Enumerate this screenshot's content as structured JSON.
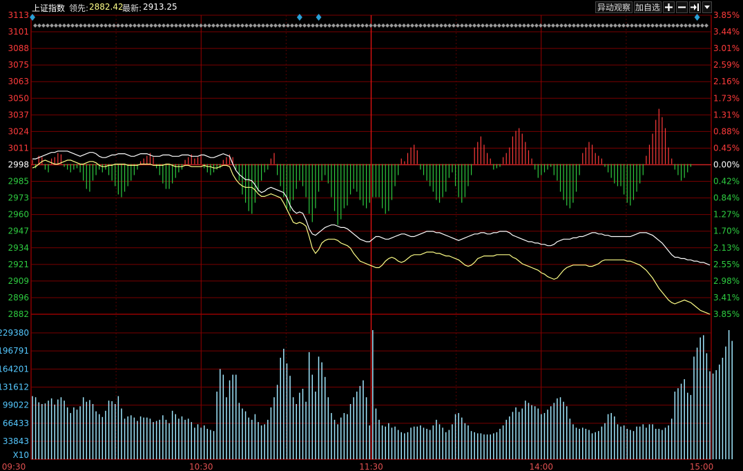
{
  "header": {
    "index_name": "上证指数",
    "lead_label": "领先:",
    "lead_value": "2882.42",
    "latest_label": "最新:",
    "latest_value": "2913.25",
    "buttons": {
      "watch": "异动观察",
      "add_watchlist": "加自选"
    },
    "icons": [
      "plus-icon",
      "minus-icon",
      "jump-end-icon",
      "dropdown-icon"
    ]
  },
  "colors": {
    "up": "#ff3b3b",
    "down": "#2ecc40",
    "grid": "#7a0000",
    "axis": "#cc0000",
    "volume": "#a0e8ff",
    "index_line": "#ffffff",
    "lead_line": "#ffff88",
    "marker": "#2a9fd6"
  },
  "chart_data": {
    "type": "line",
    "title": "",
    "price_axis_labels": [
      "3113",
      "3101",
      "3088",
      "3075",
      "3063",
      "3050",
      "3037",
      "3024",
      "3011",
      "2998",
      "2985",
      "2973",
      "2960",
      "2947",
      "2934",
      "2921",
      "2909",
      "2896",
      "2882"
    ],
    "percent_axis_labels": [
      "3.85%",
      "3.44%",
      "3.01%",
      "2.59%",
      "2.16%",
      "1.73%",
      "1.31%",
      "0.88%",
      "0.45%",
      "0.00%",
      "0.42%",
      "0.84%",
      "1.27%",
      "1.70%",
      "2.13%",
      "2.55%",
      "2.98%",
      "3.41%",
      "3.85%"
    ],
    "ylim": [
      2882,
      3113
    ],
    "prev_close": 2998,
    "time_labels": [
      "09:30",
      "10:30",
      "11:30",
      "14:00",
      "15:00"
    ],
    "volume_axis_labels": [
      "229380",
      "196791",
      "164201",
      "131612",
      "99022",
      "66433",
      "33843"
    ],
    "volume_unit": "X10",
    "volume_ylim": [
      0,
      245000
    ],
    "series": [
      {
        "key": "index",
        "values": [
          3002,
          3002,
          3003,
          3004,
          3005,
          3006,
          3007,
          3007,
          3008,
          3008,
          3008,
          3008,
          3007,
          3006,
          3005,
          3004,
          3005,
          3006,
          3007,
          3007,
          3006,
          3004,
          3003,
          3003,
          3004,
          3005,
          3005,
          3006,
          3006,
          3006,
          3005,
          3004,
          3004,
          3005,
          3006,
          3006,
          3006,
          3005,
          3004,
          3004,
          3004,
          3005,
          3005,
          3005,
          3004,
          3004,
          3004,
          3005,
          3005,
          3005,
          3004,
          3004,
          3004,
          3005,
          3005,
          3004,
          3003,
          3003,
          3004,
          3005,
          3006,
          3005,
          3004,
          2998,
          2993,
          2990,
          2988,
          2986,
          2986,
          2985,
          2982,
          2978,
          2976,
          2977,
          2979,
          2980,
          2979,
          2978,
          2977,
          2976,
          2972,
          2966,
          2962,
          2960,
          2961,
          2960,
          2955,
          2948,
          2944,
          2943,
          2945,
          2947,
          2949,
          2950,
          2951,
          2951,
          2950,
          2949,
          2949,
          2948,
          2946,
          2944,
          2942,
          2940,
          2939,
          2938,
          2938,
          2940,
          2942,
          2942,
          2941,
          2940,
          2940,
          2941,
          2942,
          2943,
          2944,
          2944,
          2943,
          2942,
          2942,
          2943,
          2944,
          2945,
          2946,
          2946,
          2946,
          2945,
          2945,
          2944,
          2943,
          2942,
          2941,
          2940,
          2939,
          2940,
          2941,
          2942,
          2943,
          2944,
          2944,
          2945,
          2945,
          2944,
          2944,
          2945,
          2945,
          2946,
          2946,
          2946,
          2945,
          2943,
          2942,
          2941,
          2940,
          2939,
          2938,
          2938,
          2937,
          2937,
          2936,
          2936,
          2935,
          2935,
          2936,
          2938,
          2939,
          2940,
          2940,
          2940,
          2941,
          2941,
          2942,
          2942,
          2943,
          2944,
          2945,
          2945,
          2944,
          2944,
          2943,
          2943,
          2942,
          2942,
          2942,
          2942,
          2942,
          2942,
          2942,
          2943,
          2944,
          2945,
          2945,
          2945,
          2944,
          2943,
          2941,
          2939,
          2937,
          2934,
          2931,
          2928,
          2926,
          2926,
          2925,
          2925,
          2924,
          2924,
          2923,
          2923,
          2922,
          2922,
          2921,
          2920
        ],
        "color": "#ffffff"
      },
      {
        "key": "lead",
        "values": [
          2995,
          2996,
          2998,
          3000,
          3001,
          3000,
          2999,
          2998,
          2998,
          2999,
          3000,
          3001,
          3001,
          3000,
          2999,
          2998,
          2998,
          2999,
          3000,
          3000,
          2999,
          2997,
          2996,
          2996,
          2997,
          2997,
          2998,
          2998,
          2998,
          2998,
          2997,
          2997,
          2997,
          2997,
          2998,
          2998,
          2998,
          2998,
          2997,
          2997,
          2997,
          2997,
          2998,
          2998,
          2997,
          2996,
          2996,
          2996,
          2997,
          2997,
          2996,
          2996,
          2996,
          2996,
          2997,
          2996,
          2996,
          2995,
          2995,
          2996,
          2997,
          2997,
          2996,
          2990,
          2986,
          2983,
          2981,
          2980,
          2980,
          2980,
          2978,
          2975,
          2973,
          2973,
          2974,
          2975,
          2974,
          2973,
          2972,
          2968,
          2963,
          2958,
          2953,
          2952,
          2953,
          2952,
          2950,
          2942,
          2933,
          2929,
          2932,
          2937,
          2939,
          2940,
          2940,
          2940,
          2939,
          2937,
          2936,
          2935,
          2933,
          2929,
          2926,
          2923,
          2922,
          2921,
          2920,
          2919,
          2918,
          2918,
          2920,
          2923,
          2925,
          2926,
          2925,
          2923,
          2922,
          2923,
          2925,
          2927,
          2928,
          2928,
          2928,
          2929,
          2930,
          2930,
          2930,
          2929,
          2929,
          2928,
          2927,
          2927,
          2926,
          2925,
          2924,
          2922,
          2920,
          2919,
          2920,
          2922,
          2925,
          2926,
          2927,
          2927,
          2927,
          2927,
          2928,
          2928,
          2928,
          2928,
          2928,
          2926,
          2925,
          2923,
          2921,
          2920,
          2919,
          2918,
          2917,
          2916,
          2914,
          2913,
          2911,
          2910,
          2909,
          2910,
          2913,
          2916,
          2918,
          2919,
          2920,
          2920,
          2920,
          2920,
          2920,
          2919,
          2919,
          2920,
          2921,
          2923,
          2924,
          2924,
          2924,
          2924,
          2924,
          2924,
          2924,
          2923,
          2923,
          2922,
          2921,
          2920,
          2918,
          2916,
          2913,
          2910,
          2906,
          2902,
          2899,
          2896,
          2893,
          2891,
          2890,
          2891,
          2892,
          2893,
          2892,
          2891,
          2889,
          2887,
          2885,
          2884,
          2883,
          2882
        ],
        "color": "#ffff88"
      }
    ],
    "ratio_bars": [
      1.5,
      -1.5,
      3,
      2.5,
      -2,
      -3,
      2,
      2.5,
      4,
      3.5,
      -1,
      -2,
      -3,
      -2,
      -1.5,
      -3,
      -6,
      -9,
      -10,
      -6,
      -4,
      -2,
      -3,
      -2,
      -4,
      -6,
      -8,
      -11,
      -12,
      -10,
      -8,
      -6,
      -4,
      -2,
      1,
      2,
      3,
      4,
      2.5,
      -1.5,
      -4,
      -7,
      -9,
      -9,
      -7,
      -5,
      -3,
      -2,
      1.5,
      2.5,
      3.5,
      2,
      2.5,
      3,
      -1.5,
      -3,
      -4,
      -3,
      -2,
      -1.5,
      1.5,
      2.5,
      3.5,
      2.5,
      -2,
      -6,
      -11,
      -14,
      -17,
      -18,
      -14,
      -10,
      -6,
      -3,
      -2,
      2,
      4,
      -4,
      -8,
      -12,
      -16,
      -17,
      -13,
      -9,
      -6,
      -8,
      -12,
      -18,
      -21,
      -16,
      -10,
      -6,
      -4,
      -7,
      -12,
      -17,
      -22,
      -20,
      -16,
      -15,
      -11,
      -9,
      -10,
      -13,
      -15,
      -16,
      -14,
      -12,
      -12,
      -12,
      -16,
      -18,
      -17,
      -13,
      -8,
      -4,
      2,
      1,
      4,
      6,
      7,
      5,
      -2,
      -4,
      -6,
      -8,
      -10,
      -13,
      -14,
      -12,
      -10,
      -5,
      -3,
      -8,
      -12,
      -14,
      -12,
      -8,
      -4,
      6,
      8,
      10,
      7,
      4,
      2,
      -2,
      -1.5,
      -1,
      2.5,
      4,
      6,
      10,
      12,
      13,
      11,
      8,
      5,
      2,
      -2,
      -5,
      -4,
      -3,
      -2,
      -1,
      -4,
      -6,
      -10,
      -13,
      -15,
      -16,
      -14,
      -10,
      -4,
      4,
      6,
      8,
      7,
      4,
      3,
      2,
      -1,
      -3,
      -5,
      -7,
      -8,
      -8,
      -11,
      -14,
      -15,
      -13,
      -10,
      -7,
      -4,
      3,
      7,
      11,
      16,
      20,
      17,
      13,
      6,
      2,
      -2,
      -4,
      -6,
      -5,
      -3,
      -1
    ],
    "volume": [
      112000,
      110000,
      101000,
      98000,
      99000,
      104000,
      108000,
      97000,
      106000,
      110000,
      104000,
      92000,
      82000,
      92000,
      88000,
      94000,
      110000,
      102000,
      105000,
      98000,
      85000,
      80000,
      75000,
      86000,
      104000,
      103000,
      98000,
      112000,
      90000,
      72000,
      76000,
      78000,
      74000,
      68000,
      76000,
      74000,
      74000,
      72000,
      66000,
      68000,
      70000,
      78000,
      70000,
      64000,
      86000,
      80000,
      72000,
      76000,
      70000,
      72000,
      66000,
      56000,
      62000,
      56000,
      60000,
      54000,
      52000,
      50000,
      120000,
      160000,
      150000,
      110000,
      140000,
      150000,
      150000,
      100000,
      90000,
      85000,
      74000,
      70000,
      80000,
      66000,
      60000,
      62000,
      70000,
      92000,
      110000,
      132000,
      180000,
      196000,
      170000,
      148000,
      110000,
      98000,
      118000,
      125000,
      102000,
      190000,
      150000,
      120000,
      182000,
      172000,
      146000,
      110000,
      82000,
      70000,
      62000,
      74000,
      82000,
      80000,
      98000,
      110000,
      120000,
      130000,
      140000,
      110000,
      60000,
      229000,
      90000,
      70000,
      60000,
      58000,
      64000,
      56000,
      58000,
      52000,
      48000,
      46000,
      48000,
      56000,
      58000,
      58000,
      60000,
      56000,
      54000,
      52000,
      60000,
      70000,
      62000,
      56000,
      48000,
      52000,
      62000,
      80000,
      82000,
      74000,
      64000,
      60000,
      50000,
      48000,
      46000,
      46000,
      44000,
      44000,
      44000,
      46000,
      48000,
      54000,
      60000,
      70000,
      76000,
      84000,
      92000,
      84000,
      90000,
      104000,
      100000,
      96000,
      94000,
      90000,
      80000,
      82000,
      88000,
      94000,
      100000,
      108000,
      110000,
      102000,
      94000,
      72000,
      62000,
      56000,
      54000,
      56000,
      54000,
      52000,
      46000,
      48000,
      50000,
      58000,
      64000,
      80000,
      82000,
      76000,
      62000,
      58000,
      60000,
      54000,
      52000,
      50000,
      58000,
      58000,
      62000,
      56000,
      62000,
      62000,
      54000,
      54000,
      52000,
      56000,
      60000,
      72000,
      120000,
      126000,
      134000,
      142000,
      118000,
      114000,
      182000,
      198000,
      216000,
      220000,
      188000,
      156000,
      152000,
      158000,
      168000,
      180000,
      200000,
      229000,
      210000
    ],
    "event_markers": [
      0,
      84,
      90,
      209
    ]
  }
}
